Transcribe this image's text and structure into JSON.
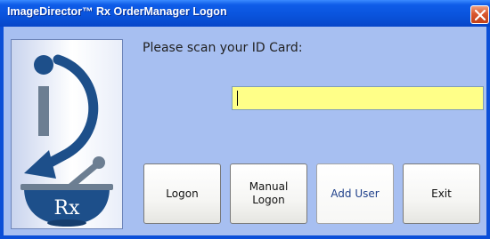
{
  "window": {
    "title": "ImageDirector™ Rx OrderManager Logon"
  },
  "logo": {
    "icon_name": "imagedirector-rx-logo",
    "mortar_text": "Rx"
  },
  "form": {
    "prompt": "Please scan your ID Card:",
    "id_input": {
      "value": "",
      "placeholder": ""
    }
  },
  "buttons": {
    "logon": "Logon",
    "manual_logon_line1": "Manual",
    "manual_logon_line2": "Logon",
    "add_user": "Add User",
    "exit": "Exit"
  },
  "colors": {
    "titlebar": "#0a54dd",
    "client_bg": "#a7bff1",
    "input_bg": "#ffff88",
    "close_button": "#d9582f",
    "logo_blue": "#1d4f8a",
    "logo_gray": "#6c7e92"
  }
}
